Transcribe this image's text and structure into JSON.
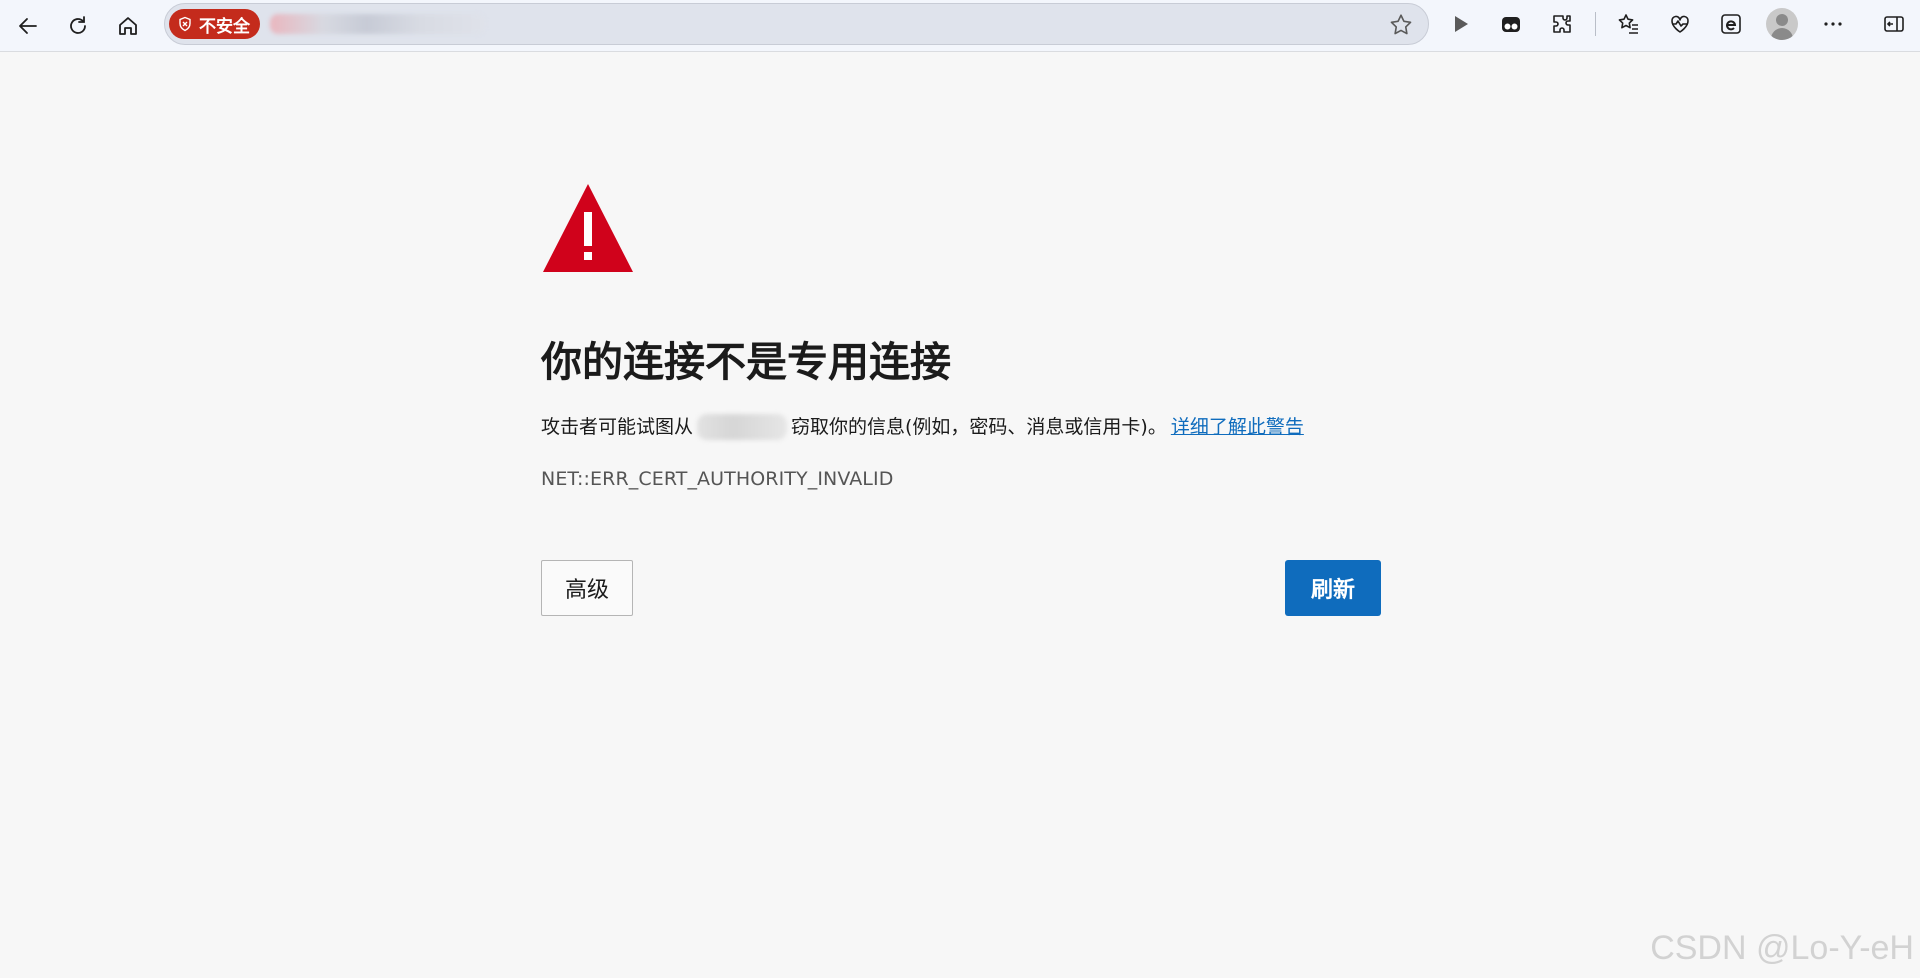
{
  "toolbar": {
    "icons": {
      "back": "back-arrow-icon",
      "refresh": "refresh-icon",
      "home": "home-icon",
      "favorite": "star-icon",
      "media": "play-icon",
      "app": "app-icon",
      "extensions": "puzzle-icon",
      "favorites": "favorites-icon",
      "performance": "heartbeat-icon",
      "ie_mode": "ie-mode-icon",
      "profile": "profile-icon",
      "menu": "more-icon",
      "sidebar": "sidebar-icon"
    }
  },
  "addressbar": {
    "security_label": "不安全",
    "badge_color": "#c42b1c"
  },
  "page": {
    "title": "你的连接不是专用连接",
    "description_before": "攻击者可能试图从",
    "description_after": "窃取你的信息(例如，密码、消息或信用卡)。",
    "learn_more": "详细了解此警告",
    "error_code": "NET::ERR_CERT_AUTHORITY_INVALID",
    "advanced_button": "高级",
    "refresh_button": "刷新",
    "accent_color": "#0f6cbd",
    "warning_color": "#d0021b"
  },
  "watermark": "CSDN @Lo-Y-eH"
}
